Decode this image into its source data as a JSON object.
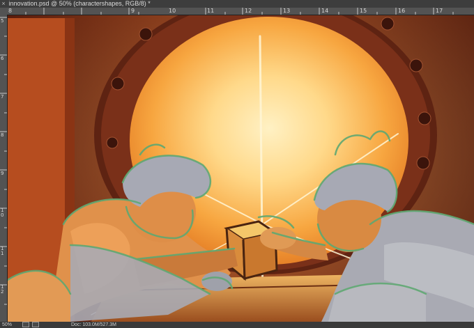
{
  "document_tab": {
    "close_glyph": "×",
    "title": "innovation.psd @ 50% (charactershapes, RGB/8) *"
  },
  "ruler": {
    "top_numbers": [
      "8",
      "9",
      "10",
      "11",
      "12",
      "13",
      "14",
      "15",
      "16",
      "17"
    ],
    "left_numbers": [
      "5",
      "6",
      "7",
      "8",
      "9",
      "1 0",
      "1 1",
      "1 2"
    ]
  },
  "status_bar": {
    "zoom": "50%",
    "doc_info": "Doc: 103.0M/527.3M"
  },
  "colors": {
    "ui_dark": "#2b2b2b",
    "ruler": "#535353",
    "glow": "#ffe9a8",
    "porthole_frame": "#6b2a18",
    "sketch_green": "#5fa872",
    "hair_grey": "#a7a9b4"
  },
  "icons": [
    "close-icon",
    "status-icon"
  ]
}
